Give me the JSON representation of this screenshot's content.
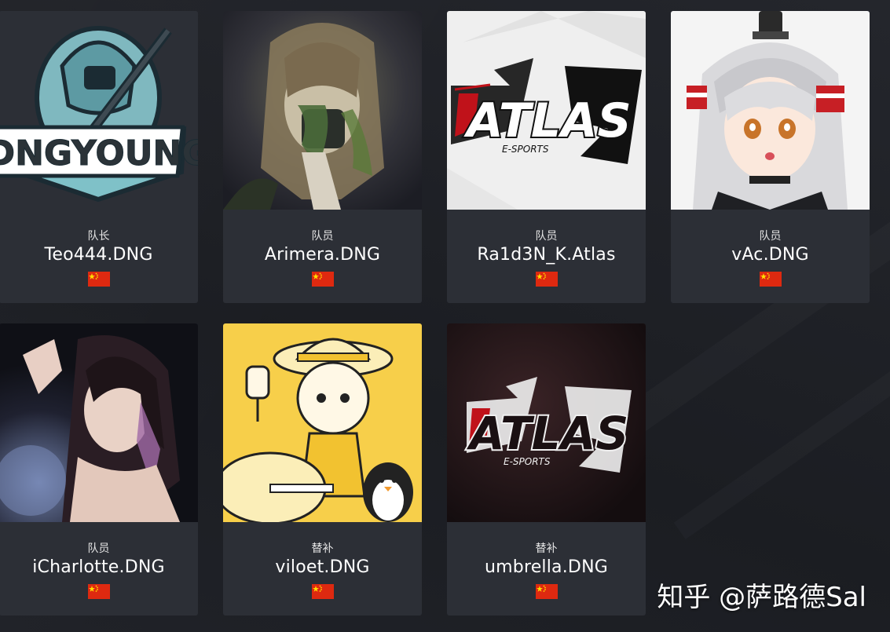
{
  "players": [
    {
      "role": "队长",
      "name": "Teo444.DNG",
      "avatar": "dngyoung-logo",
      "flag": "china-flag"
    },
    {
      "role": "队员",
      "name": "Arimera.DNG",
      "avatar": "painted-girl-portrait",
      "flag": "china-flag"
    },
    {
      "role": "队员",
      "name": "Ra1d3N_K.Atlas",
      "avatar": "atlas-esports-logo-light",
      "flag": "china-flag"
    },
    {
      "role": "队员",
      "name": "vAc.DNG",
      "avatar": "anime-girl-white-hair",
      "flag": "china-flag"
    },
    {
      "role": "队员",
      "name": "iCharlotte.DNG",
      "avatar": "photo-portrait",
      "flag": "china-flag"
    },
    {
      "role": "替补",
      "name": "viloet.DNG",
      "avatar": "cartoon-girl-guitar",
      "flag": "china-flag"
    },
    {
      "role": "替补",
      "name": "umbrella.DNG",
      "avatar": "atlas-esports-logo-dark",
      "flag": "china-flag"
    }
  ],
  "logos": {
    "dngyoung_text": "DNGYOUNG",
    "atlas_text": "ATLAS",
    "atlas_sub": "E-SPORTS"
  },
  "watermark": "知乎 @萨路德Sal",
  "colors": {
    "card_bg": "#2c2f36",
    "page_bg": "#1d1f24",
    "flag_red": "#de2910",
    "flag_yellow": "#ffde00"
  }
}
